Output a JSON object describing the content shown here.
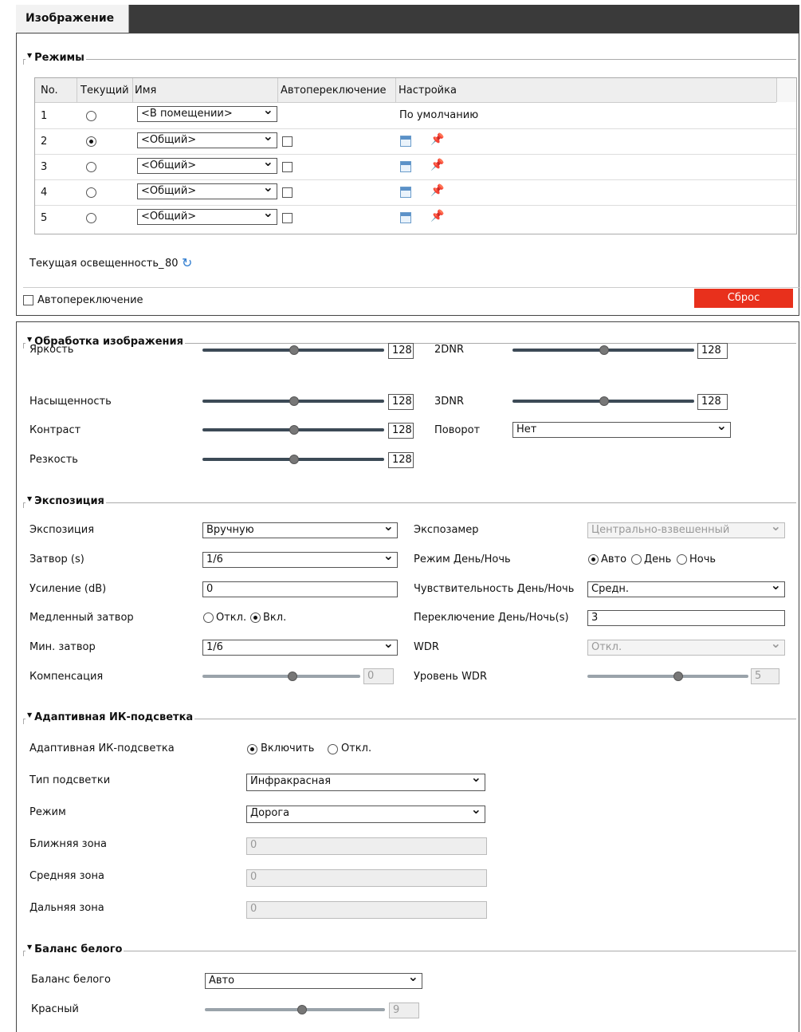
{
  "tab": "Изображение",
  "modes": {
    "title": "Режимы",
    "headers": [
      "No.",
      "Текущий",
      "Имя",
      "Автопереключение",
      "Настройка"
    ],
    "rows": [
      {
        "no": "1",
        "current": false,
        "name": "<В помещении>",
        "setting": "По умолчанию"
      },
      {
        "no": "2",
        "current": true,
        "name": "<Общий>",
        "setting": ""
      },
      {
        "no": "3",
        "current": false,
        "name": "<Общий>",
        "setting": ""
      },
      {
        "no": "4",
        "current": false,
        "name": "<Общий>",
        "setting": ""
      },
      {
        "no": "5",
        "current": false,
        "name": "<Общий>",
        "setting": ""
      }
    ],
    "illumination_label": "Текущая освещенность_",
    "illumination_value": "80",
    "auto_switch_label": "Автопереключение",
    "reset_button": "Сброс"
  },
  "processing": {
    "title": "Обработка изображения",
    "brightness": {
      "label": "Яркость",
      "value": "128"
    },
    "saturation": {
      "label": "Насыщенность",
      "value": "128"
    },
    "contrast": {
      "label": "Контраст",
      "value": "128"
    },
    "sharpness": {
      "label": "Резкость",
      "value": "128"
    },
    "dnr2": {
      "label": "2DNR",
      "value": "128"
    },
    "dnr3": {
      "label": "3DNR",
      "value": "128"
    },
    "rotation": {
      "label": "Поворот",
      "value": "Нет"
    }
  },
  "exposure": {
    "title": "Экспозиция",
    "mode": {
      "label": "Экспозиция",
      "value": "Вручную"
    },
    "shutter": {
      "label": "Затвор (s)",
      "value": "1/6"
    },
    "gain": {
      "label": "Усиление (dB)",
      "value": "0"
    },
    "slow_shutter": {
      "label": "Медленный затвор",
      "opt_off": "Откл.",
      "opt_on": "Вкл."
    },
    "min_shutter": {
      "label": "Мин. затвор",
      "value": "1/6"
    },
    "compensation": {
      "label": "Компенсация",
      "value": "0"
    },
    "metering": {
      "label": "Экспозамер",
      "value": "Центрально-взвешенный"
    },
    "daynight": {
      "label": "Режим День/Ночь",
      "opt_auto": "Авто",
      "opt_day": "День",
      "opt_night": "Ночь"
    },
    "daynight_sens": {
      "label": "Чувствительность День/Ночь",
      "value": "Средн."
    },
    "daynight_switch": {
      "label": "Переключение День/Ночь(s)",
      "value": "3"
    },
    "wdr": {
      "label": "WDR",
      "value": "Откл."
    },
    "wdr_level": {
      "label": "Уровень WDR",
      "value": "5"
    }
  },
  "ir": {
    "title": "Адаптивная ИК-подсветка",
    "adaptive": {
      "label": "Адаптивная ИК-подсветка",
      "opt_on": "Включить",
      "opt_off": "Откл."
    },
    "type": {
      "label": "Тип подсветки",
      "value": "Инфракрасная"
    },
    "mode": {
      "label": "Режим",
      "value": "Дорога"
    },
    "near": {
      "label": "Ближняя зона",
      "value": "0"
    },
    "middle": {
      "label": "Средняя зона",
      "value": "0"
    },
    "far": {
      "label": "Дальняя зона",
      "value": "0"
    }
  },
  "wb": {
    "title": "Баланс белого",
    "mode": {
      "label": "Баланс белого",
      "value": "Авто"
    },
    "red": {
      "label": "Красный",
      "value": "9"
    }
  }
}
